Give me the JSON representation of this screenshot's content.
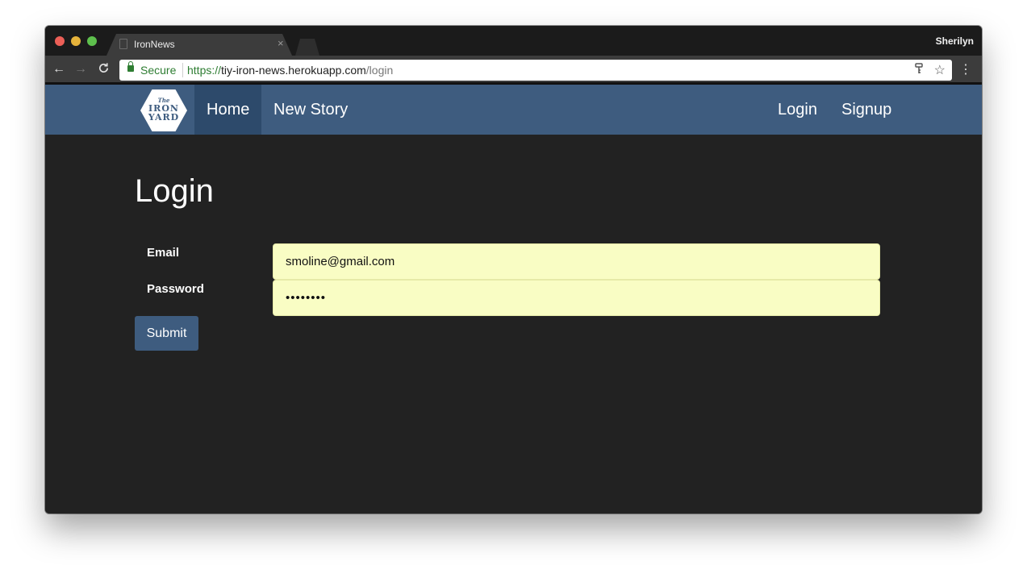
{
  "browser": {
    "tab_title": "IronNews",
    "tab_close": "×",
    "profile": "Sherilyn",
    "secure_label": "Secure",
    "url_proto": "https://",
    "url_host": "tiy-iron-news.herokuapp.com",
    "url_path": "/login",
    "icons": {
      "back": "←",
      "forward": "→",
      "reload": "C",
      "key": "⚲",
      "star": "☆",
      "menu": "⋮"
    }
  },
  "site": {
    "logo": {
      "the": "The",
      "iron": "IRON",
      "yard": "YARD"
    },
    "nav": {
      "home": "Home",
      "new_story": "New Story",
      "login": "Login",
      "signup": "Signup"
    },
    "colors": {
      "navbar": "#3e5c7f",
      "active": "#2d4a6b",
      "background": "#222222",
      "field": "#f9fdc4"
    }
  },
  "form": {
    "title": "Login",
    "email_label": "Email",
    "email_value": "smoline@gmail.com",
    "password_label": "Password",
    "password_value": "••••••••",
    "submit_label": "Submit"
  }
}
